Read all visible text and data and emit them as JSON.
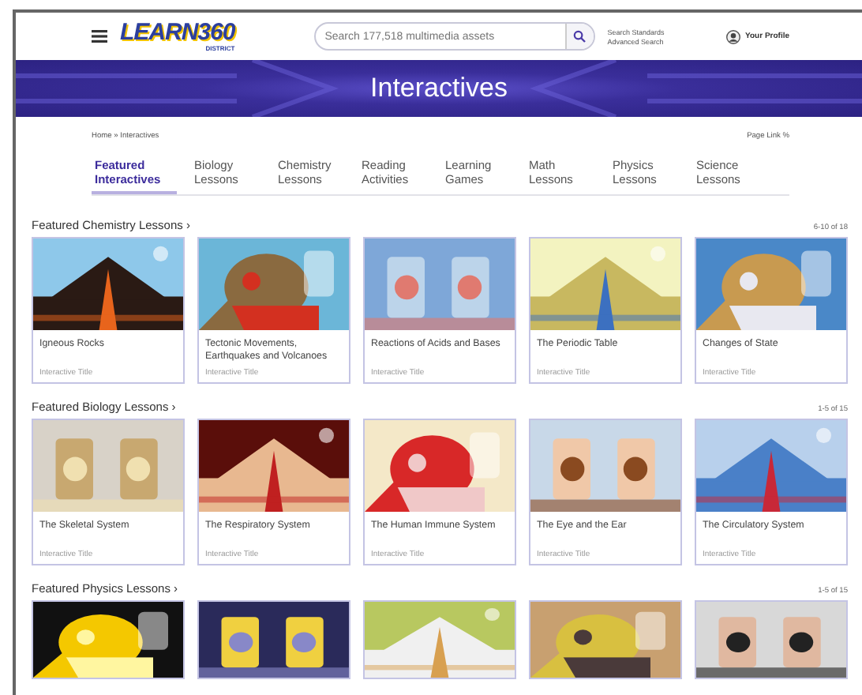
{
  "header": {
    "logo": "LEARN360",
    "logo_sub": "DISTRICT",
    "search": {
      "placeholder": "Search 177,518 multimedia assets"
    },
    "links": [
      "Search Standards",
      "Advanced Search"
    ],
    "profile": "Your Profile"
  },
  "banner": {
    "title": "Interactives"
  },
  "breadcrumb": "Home » Interactives",
  "page_link": "Page Link %",
  "tabs": [
    {
      "label": "Featured Interactives",
      "selected": true
    },
    {
      "label": "Biology Lessons",
      "selected": false
    },
    {
      "label": "Chemistry Lessons",
      "selected": false
    },
    {
      "label": "Reading Activities",
      "selected": false
    },
    {
      "label": "Learning Games",
      "selected": false
    },
    {
      "label": "Math Lessons",
      "selected": false
    },
    {
      "label": "Physics Lessons",
      "selected": false
    },
    {
      "label": "Science Lessons",
      "selected": false
    }
  ],
  "sections": [
    {
      "title": "Featured Chemistry Lessons ›",
      "count": "6-10 of 18",
      "cards": [
        {
          "title": "Igneous Rocks",
          "subtitle": "Interactive Title"
        },
        {
          "title": "Tectonic Movements, Earthquakes and Volcanoes",
          "subtitle": "Interactive Title"
        },
        {
          "title": "Reactions of Acids and Bases",
          "subtitle": "Interactive Title"
        },
        {
          "title": "The Periodic Table",
          "subtitle": "Interactive Title"
        },
        {
          "title": "Changes of State",
          "subtitle": "Interactive Title"
        }
      ]
    },
    {
      "title": "Featured Biology Lessons ›",
      "count": "1-5 of 15",
      "cards": [
        {
          "title": "The Skeletal System",
          "subtitle": "Interactive Title"
        },
        {
          "title": "The Respiratory System",
          "subtitle": "Interactive Title"
        },
        {
          "title": "The Human Immune System",
          "subtitle": "Interactive Title"
        },
        {
          "title": "The Eye and the Ear",
          "subtitle": "Interactive Title"
        },
        {
          "title": "The Circulatory System",
          "subtitle": "Interactive Title"
        }
      ]
    },
    {
      "title": "Featured Physics Lessons ›",
      "count": "1-5 of 15"
    }
  ]
}
